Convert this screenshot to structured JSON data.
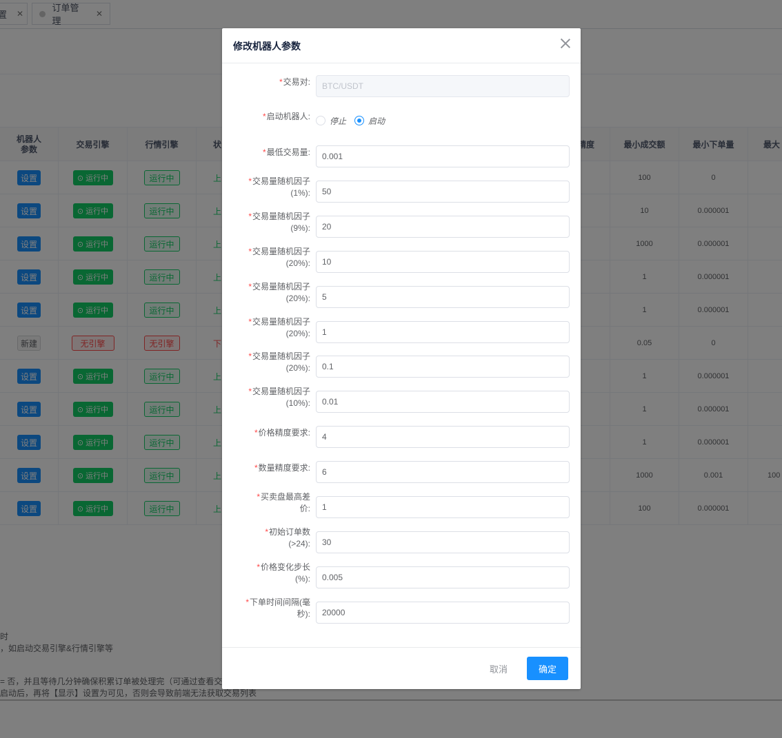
{
  "tabs": [
    {
      "label": "置"
    },
    {
      "label": "订单管理"
    }
  ],
  "table": {
    "headers": {
      "robot_params": "机器人\n参数",
      "trade_engine": "交易引擎",
      "market_engine": "行情引擎",
      "status": "状",
      "precision": "精度",
      "min_deal_amount": "最小成交额",
      "min_order_qty": "最小下单量",
      "max": "最大"
    },
    "rows": [
      {
        "action": "设置",
        "trade": "⊙ 运行中",
        "market": "运行中",
        "status": "上",
        "min_deal": "100",
        "min_order": "0",
        "max": ""
      },
      {
        "action": "设置",
        "trade": "⊙ 运行中",
        "market": "运行中",
        "status": "上",
        "min_deal": "10",
        "min_order": "0.000001",
        "max": ""
      },
      {
        "action": "设置",
        "trade": "⊙ 运行中",
        "market": "运行中",
        "status": "上",
        "min_deal": "1000",
        "min_order": "0.000001",
        "max": ""
      },
      {
        "action": "设置",
        "trade": "⊙ 运行中",
        "market": "运行中",
        "status": "上",
        "min_deal": "1",
        "min_order": "0.000001",
        "max": ""
      },
      {
        "action": "设置",
        "trade": "⊙ 运行中",
        "market": "运行中",
        "status": "上",
        "min_deal": "1",
        "min_order": "0.000001",
        "max": ""
      },
      {
        "action": "新建",
        "trade": "无引擎",
        "market": "无引擎",
        "status": "下",
        "min_deal": "0.05",
        "min_order": "0",
        "max": ""
      },
      {
        "action": "设置",
        "trade": "⊙ 运行中",
        "market": "运行中",
        "status": "上",
        "min_deal": "1",
        "min_order": "0.000001",
        "max": ""
      },
      {
        "action": "设置",
        "trade": "⊙ 运行中",
        "market": "运行中",
        "status": "上",
        "min_deal": "1",
        "min_order": "0.000001",
        "max": ""
      },
      {
        "action": "设置",
        "trade": "⊙ 运行中",
        "market": "运行中",
        "status": "上",
        "min_deal": "1",
        "min_order": "0.000001",
        "max": ""
      },
      {
        "action": "设置",
        "trade": "⊙ 运行中",
        "market": "运行中",
        "status": "上",
        "min_deal": "1000",
        "min_order": "0.001",
        "max": "100"
      },
      {
        "action": "设置",
        "trade": "⊙ 运行中",
        "market": "运行中",
        "status": "上",
        "min_deal": "100",
        "min_order": "0.000001",
        "max": ""
      }
    ]
  },
  "notes": {
    "line1": "时",
    "line2": "，如启动交易引擎&行情引擎等",
    "line3": "= 否，并且等待几分钟确保积累订单被处理完（可通过查看交易引",
    "line4": "启动后，再将【显示】设置为可见，否则会导致前端无法获取交易列表"
  },
  "dialog": {
    "title": "修改机器人参数",
    "fields": {
      "pair": {
        "label1": "交易对:",
        "value": "BTC/USDT"
      },
      "start_robot": {
        "label1": "启动机器人:",
        "option_stop": "停止",
        "option_start": "启动",
        "selected": "启动"
      },
      "min_volume": {
        "label1": "最低交易量:",
        "value": "0.001"
      },
      "factor1": {
        "label1": "交易量随机因子",
        "label2": "(1%):",
        "value": "50"
      },
      "factor2": {
        "label1": "交易量随机因子",
        "label2": "(9%):",
        "value": "20"
      },
      "factor3": {
        "label1": "交易量随机因子",
        "label2": "(20%):",
        "value": "10"
      },
      "factor4": {
        "label1": "交易量随机因子",
        "label2": "(20%):",
        "value": "5"
      },
      "factor5": {
        "label1": "交易量随机因子",
        "label2": "(20%):",
        "value": "1"
      },
      "factor6": {
        "label1": "交易量随机因子",
        "label2": "(20%):",
        "value": "0.1"
      },
      "factor7": {
        "label1": "交易量随机因子",
        "label2": "(10%):",
        "value": "0.01"
      },
      "price_precision": {
        "label1": "价格精度要求:",
        "value": "4"
      },
      "qty_precision": {
        "label1": "数量精度要求:",
        "value": "6"
      },
      "max_spread": {
        "label1": "买卖盘最高差",
        "label2": "价:",
        "value": "1"
      },
      "init_orders": {
        "label1": "初始订单数",
        "label2": "(>24):",
        "value": "30"
      },
      "price_step": {
        "label1": "价格变化步长",
        "label2": "(%):",
        "value": "0.005"
      },
      "interval": {
        "label1": "下单时间间隔(毫",
        "label2": "秒):",
        "value": "20000"
      }
    },
    "cancel_label": "取消",
    "ok_label": "确定"
  },
  "colors": {
    "primary": "#1890ff",
    "success": "#13ce66",
    "danger": "#ff4949"
  }
}
